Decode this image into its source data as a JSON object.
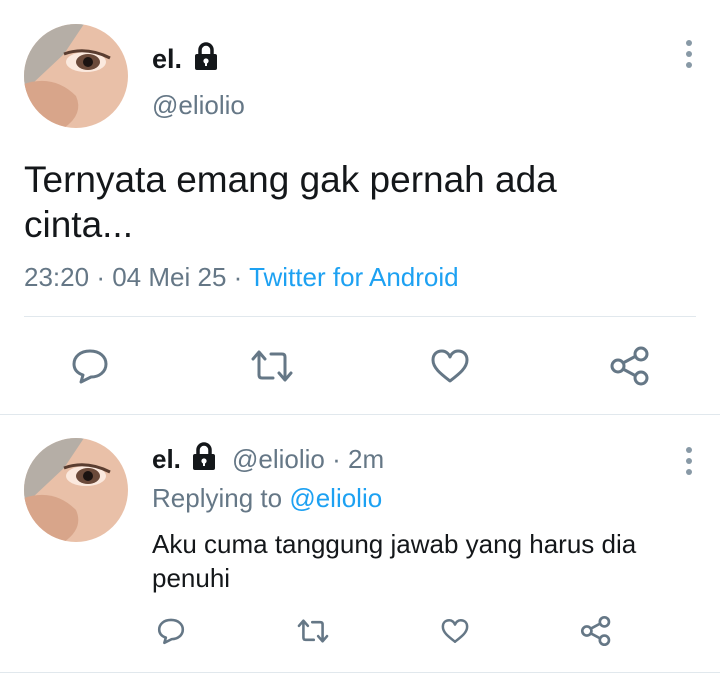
{
  "colors": {
    "accent": "#1da1f2",
    "muted": "#657786",
    "icon": "#657786",
    "divider": "#e1e8ed"
  },
  "main_tweet": {
    "display_name": "el.",
    "handle": "@eliolio",
    "text_line1": "Ternyata emang gak pernah ada",
    "text_line2": "cinta...",
    "time": "23:20",
    "sep1": "·",
    "date": "04 Mei 25",
    "sep2": "·",
    "source": "Twitter for Android",
    "icons": [
      "lock-icon",
      "more-icon",
      "reply-icon",
      "retweet-icon",
      "like-icon",
      "share-icon"
    ]
  },
  "reply_tweet": {
    "display_name": "el.",
    "handle": "@eliolio",
    "sep": "·",
    "age": "2m",
    "replying_prefix": "Replying to",
    "replying_handle": "@eliolio",
    "text_line1": "Aku cuma tanggung jawab yang harus dia",
    "text_line2": "penuhi",
    "icons": [
      "lock-icon",
      "more-icon",
      "reply-icon",
      "retweet-icon",
      "like-icon",
      "share-icon"
    ]
  }
}
